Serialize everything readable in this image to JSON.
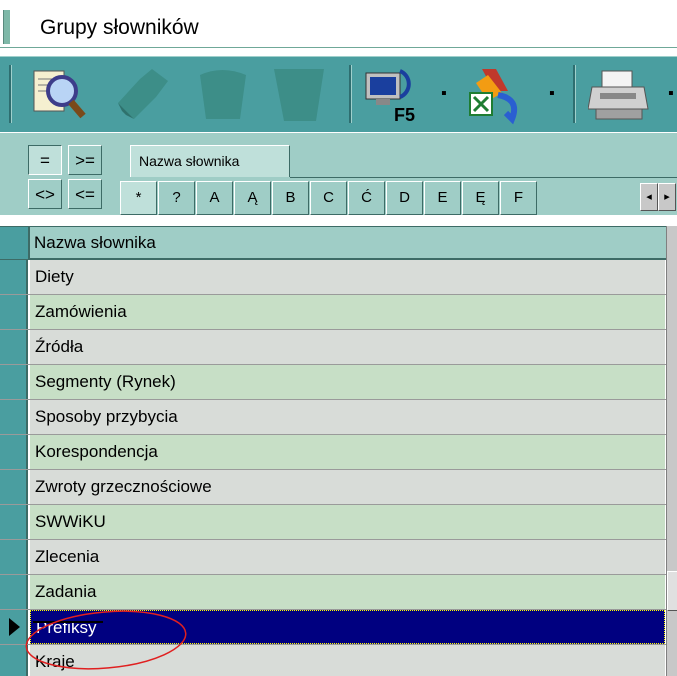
{
  "window": {
    "title": "Grupy słowników"
  },
  "toolbar": {
    "buttons": [
      {
        "icon": "search-magnifier-icon"
      },
      {
        "icon": "edit-paint-icon"
      },
      {
        "icon": "add-bucket-icon"
      },
      {
        "icon": "delete-bucket-icon"
      },
      {
        "icon": "refresh-f5-icon",
        "label": "F5"
      },
      {
        "icon": "export-excel-icon"
      },
      {
        "icon": "printer-icon"
      }
    ]
  },
  "filter": {
    "operators": [
      "=",
      ">=",
      "<>",
      "<="
    ],
    "field_tab": "Nazwa słownika",
    "letters": [
      "*",
      "?",
      "A",
      "Ą",
      "B",
      "C",
      "Ć",
      "D",
      "E",
      "Ę",
      "F"
    ]
  },
  "grid": {
    "column_header": "Nazwa słownika",
    "rows": [
      "Diety",
      "Zamówienia",
      "Źródła",
      "Segmenty (Rynek)",
      "Sposoby przybycia",
      "Korespondencja",
      "Zwroty grzecznościowe",
      "SWWiKU",
      "Zlecenia",
      "Zadania",
      "Prefiksy",
      "Kraje"
    ],
    "current_index": 10
  },
  "colors": {
    "toolbar": "#4a9ea0",
    "row_even": "#d8dcd8",
    "row_odd": "#c7dfc6",
    "selection": "#000080",
    "annotation": "#e02020"
  }
}
